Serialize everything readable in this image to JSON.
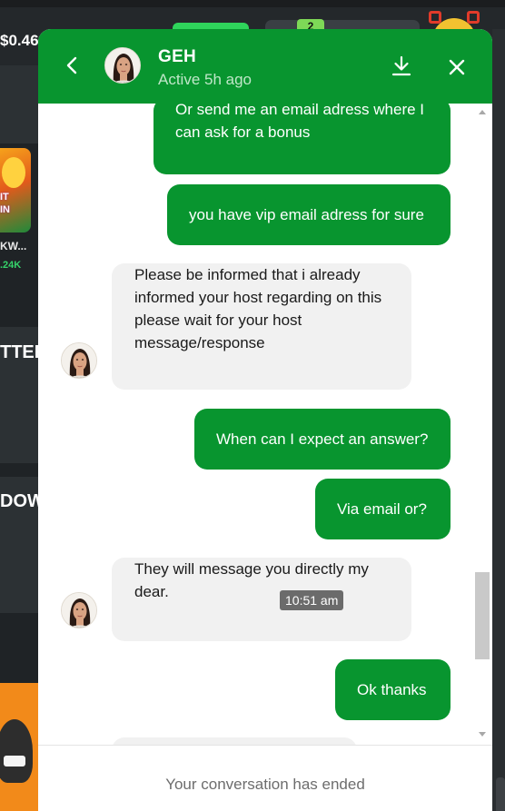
{
  "background": {
    "balance": "$0.46",
    "level_badge": "2",
    "game_tile": {
      "art_text_1": "IT",
      "art_text_2": "IN",
      "name": "KW...",
      "stat": ".24K"
    },
    "section_heading_1": "TTER",
    "section_heading_2": "DOW"
  },
  "chat": {
    "agent_name": "GEH",
    "agent_status": "Active 5h ago",
    "messages": [
      {
        "direction": "outgoing",
        "text": "Or send me an email adress where I can ask for a bonus"
      },
      {
        "direction": "outgoing",
        "text": "you have vip email adress for sure"
      },
      {
        "direction": "incoming",
        "text": "Please be informed that i already informed your host regarding on this please wait for your host message/response"
      },
      {
        "direction": "outgoing",
        "text": "When can I expect an answer?"
      },
      {
        "direction": "outgoing",
        "text": "Via email or?"
      },
      {
        "direction": "incoming",
        "text": "They will message you directly my dear."
      },
      {
        "direction": "outgoing",
        "text": "Ok thanks"
      }
    ],
    "hover_timestamp": "10:51 am",
    "footer_text": "Your conversation has ended"
  },
  "colors": {
    "brand_green": "#08952f",
    "incoming_bubble": "#f1f1f1",
    "background_dark": "#1f2326"
  },
  "icons": [
    "back-arrow-icon",
    "download-icon",
    "close-icon"
  ]
}
